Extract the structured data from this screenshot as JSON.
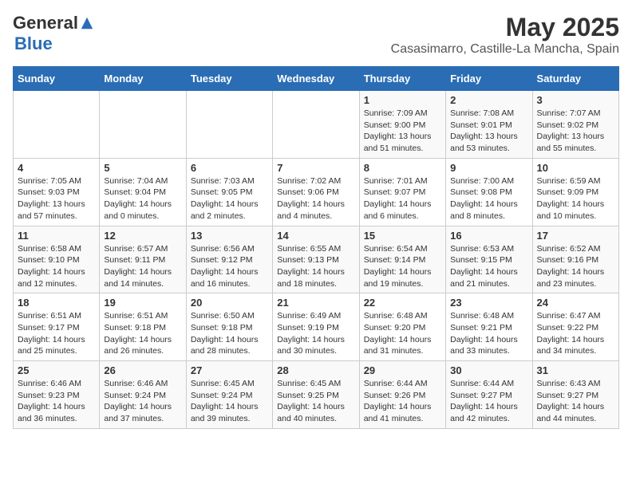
{
  "logo": {
    "general": "General",
    "blue": "Blue"
  },
  "title": "May 2025",
  "subtitle": "Casasimarro, Castille-La Mancha, Spain",
  "days_of_week": [
    "Sunday",
    "Monday",
    "Tuesday",
    "Wednesday",
    "Thursday",
    "Friday",
    "Saturday"
  ],
  "weeks": [
    [
      {
        "day": "",
        "info": ""
      },
      {
        "day": "",
        "info": ""
      },
      {
        "day": "",
        "info": ""
      },
      {
        "day": "",
        "info": ""
      },
      {
        "day": "1",
        "info": "Sunrise: 7:09 AM\nSunset: 9:00 PM\nDaylight: 13 hours\nand 51 minutes."
      },
      {
        "day": "2",
        "info": "Sunrise: 7:08 AM\nSunset: 9:01 PM\nDaylight: 13 hours\nand 53 minutes."
      },
      {
        "day": "3",
        "info": "Sunrise: 7:07 AM\nSunset: 9:02 PM\nDaylight: 13 hours\nand 55 minutes."
      }
    ],
    [
      {
        "day": "4",
        "info": "Sunrise: 7:05 AM\nSunset: 9:03 PM\nDaylight: 13 hours\nand 57 minutes."
      },
      {
        "day": "5",
        "info": "Sunrise: 7:04 AM\nSunset: 9:04 PM\nDaylight: 14 hours\nand 0 minutes."
      },
      {
        "day": "6",
        "info": "Sunrise: 7:03 AM\nSunset: 9:05 PM\nDaylight: 14 hours\nand 2 minutes."
      },
      {
        "day": "7",
        "info": "Sunrise: 7:02 AM\nSunset: 9:06 PM\nDaylight: 14 hours\nand 4 minutes."
      },
      {
        "day": "8",
        "info": "Sunrise: 7:01 AM\nSunset: 9:07 PM\nDaylight: 14 hours\nand 6 minutes."
      },
      {
        "day": "9",
        "info": "Sunrise: 7:00 AM\nSunset: 9:08 PM\nDaylight: 14 hours\nand 8 minutes."
      },
      {
        "day": "10",
        "info": "Sunrise: 6:59 AM\nSunset: 9:09 PM\nDaylight: 14 hours\nand 10 minutes."
      }
    ],
    [
      {
        "day": "11",
        "info": "Sunrise: 6:58 AM\nSunset: 9:10 PM\nDaylight: 14 hours\nand 12 minutes."
      },
      {
        "day": "12",
        "info": "Sunrise: 6:57 AM\nSunset: 9:11 PM\nDaylight: 14 hours\nand 14 minutes."
      },
      {
        "day": "13",
        "info": "Sunrise: 6:56 AM\nSunset: 9:12 PM\nDaylight: 14 hours\nand 16 minutes."
      },
      {
        "day": "14",
        "info": "Sunrise: 6:55 AM\nSunset: 9:13 PM\nDaylight: 14 hours\nand 18 minutes."
      },
      {
        "day": "15",
        "info": "Sunrise: 6:54 AM\nSunset: 9:14 PM\nDaylight: 14 hours\nand 19 minutes."
      },
      {
        "day": "16",
        "info": "Sunrise: 6:53 AM\nSunset: 9:15 PM\nDaylight: 14 hours\nand 21 minutes."
      },
      {
        "day": "17",
        "info": "Sunrise: 6:52 AM\nSunset: 9:16 PM\nDaylight: 14 hours\nand 23 minutes."
      }
    ],
    [
      {
        "day": "18",
        "info": "Sunrise: 6:51 AM\nSunset: 9:17 PM\nDaylight: 14 hours\nand 25 minutes."
      },
      {
        "day": "19",
        "info": "Sunrise: 6:51 AM\nSunset: 9:18 PM\nDaylight: 14 hours\nand 26 minutes."
      },
      {
        "day": "20",
        "info": "Sunrise: 6:50 AM\nSunset: 9:18 PM\nDaylight: 14 hours\nand 28 minutes."
      },
      {
        "day": "21",
        "info": "Sunrise: 6:49 AM\nSunset: 9:19 PM\nDaylight: 14 hours\nand 30 minutes."
      },
      {
        "day": "22",
        "info": "Sunrise: 6:48 AM\nSunset: 9:20 PM\nDaylight: 14 hours\nand 31 minutes."
      },
      {
        "day": "23",
        "info": "Sunrise: 6:48 AM\nSunset: 9:21 PM\nDaylight: 14 hours\nand 33 minutes."
      },
      {
        "day": "24",
        "info": "Sunrise: 6:47 AM\nSunset: 9:22 PM\nDaylight: 14 hours\nand 34 minutes."
      }
    ],
    [
      {
        "day": "25",
        "info": "Sunrise: 6:46 AM\nSunset: 9:23 PM\nDaylight: 14 hours\nand 36 minutes."
      },
      {
        "day": "26",
        "info": "Sunrise: 6:46 AM\nSunset: 9:24 PM\nDaylight: 14 hours\nand 37 minutes."
      },
      {
        "day": "27",
        "info": "Sunrise: 6:45 AM\nSunset: 9:24 PM\nDaylight: 14 hours\nand 39 minutes."
      },
      {
        "day": "28",
        "info": "Sunrise: 6:45 AM\nSunset: 9:25 PM\nDaylight: 14 hours\nand 40 minutes."
      },
      {
        "day": "29",
        "info": "Sunrise: 6:44 AM\nSunset: 9:26 PM\nDaylight: 14 hours\nand 41 minutes."
      },
      {
        "day": "30",
        "info": "Sunrise: 6:44 AM\nSunset: 9:27 PM\nDaylight: 14 hours\nand 42 minutes."
      },
      {
        "day": "31",
        "info": "Sunrise: 6:43 AM\nSunset: 9:27 PM\nDaylight: 14 hours\nand 44 minutes."
      }
    ]
  ]
}
